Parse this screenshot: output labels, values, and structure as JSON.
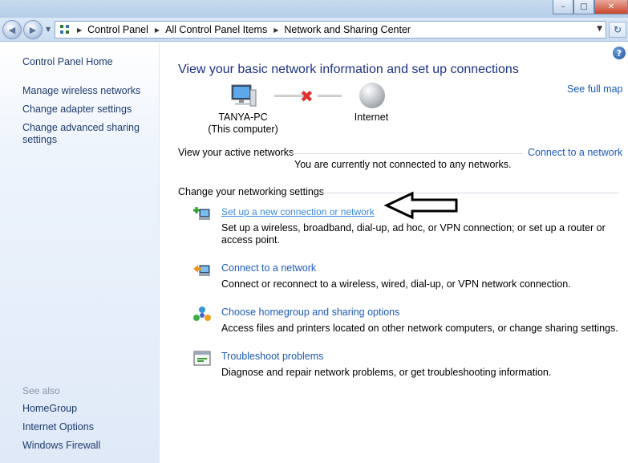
{
  "window": {
    "min_glyph": "–",
    "max_glyph": "□",
    "close_glyph": "✕"
  },
  "toolbar": {
    "back_glyph": "◀",
    "forward_glyph": "▶",
    "breadcrumbs": [
      "Control Panel",
      "All Control Panel Items",
      "Network and Sharing Center"
    ],
    "dropdown_glyph": "▼",
    "refresh_glyph": "↻"
  },
  "sidebar": {
    "home": "Control Panel Home",
    "links": [
      "Manage wireless networks",
      "Change adapter settings",
      "Change advanced sharing settings"
    ],
    "see_also_label": "See also",
    "see_also": [
      "HomeGroup",
      "Internet Options",
      "Windows Firewall"
    ]
  },
  "main": {
    "help_glyph": "?",
    "title": "View your basic network information and set up connections",
    "see_full_map": "See full map",
    "computer_name": "TANYA-PC",
    "computer_sub": "(This computer)",
    "internet_label": "Internet",
    "disconnected_glyph": "✖",
    "active_networks_label": "View your active networks",
    "connect_link": "Connect to a network",
    "not_connected_text": "You are currently not connected to any networks.",
    "change_settings_label": "Change your networking settings",
    "tasks": [
      {
        "title": "Set up a new connection or network",
        "desc": "Set up a wireless, broadband, dial-up, ad hoc, or VPN connection; or set up a router or access point.",
        "icon": "new-connection-icon"
      },
      {
        "title": "Connect to a network",
        "desc": "Connect or reconnect to a wireless, wired, dial-up, or VPN network connection.",
        "icon": "connect-network-icon"
      },
      {
        "title": "Choose homegroup and sharing options",
        "desc": "Access files and printers located on other network computers, or change sharing settings.",
        "icon": "homegroup-icon"
      },
      {
        "title": "Troubleshoot problems",
        "desc": "Diagnose and repair network problems, or get troubleshooting information.",
        "icon": "troubleshoot-icon"
      }
    ]
  },
  "colors": {
    "link": "#1c5ab8",
    "title": "#1e3287",
    "sidebar_link": "#1e3a6e"
  }
}
